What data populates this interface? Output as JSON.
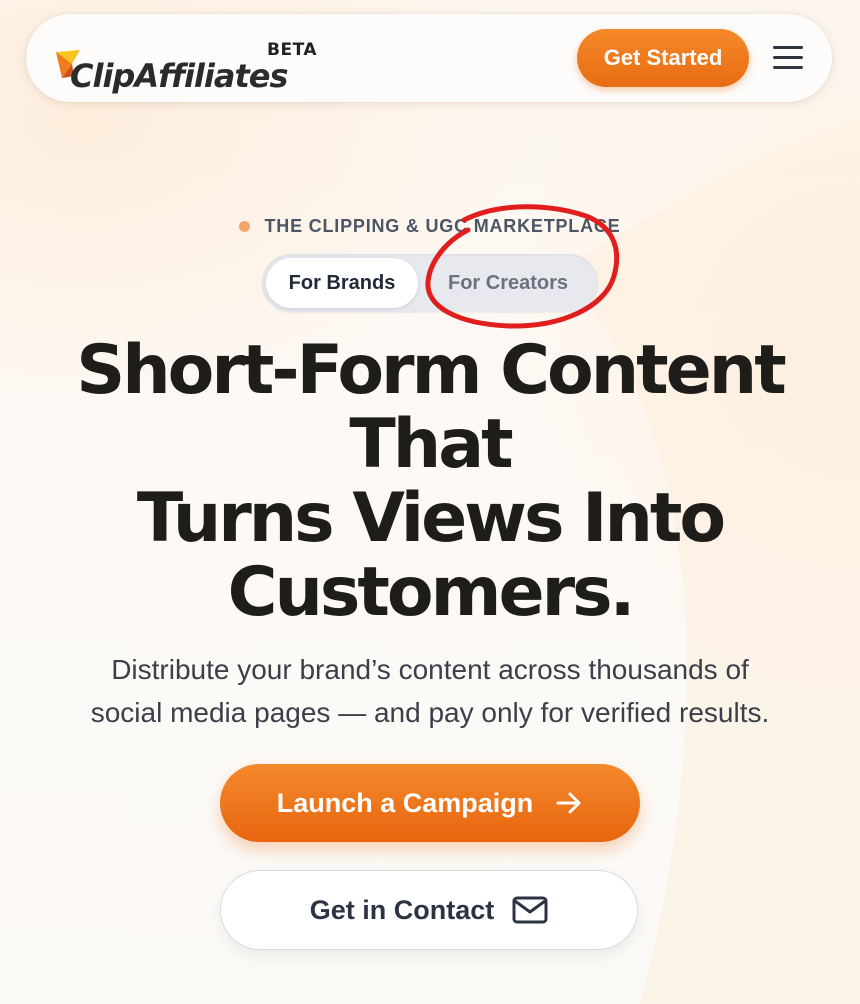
{
  "header": {
    "brand": "ClipAffiliates",
    "badge": "BETA",
    "cta_label": "Get Started",
    "menu_icon": "hamburger-menu-icon"
  },
  "hero": {
    "eyebrow": "THE CLIPPING & UGC MARKETPLACE",
    "toggle": {
      "options": [
        "For Brands",
        "For Creators"
      ],
      "selected": "For Brands"
    },
    "headline_lines": [
      "Short-Form Content",
      "That",
      "Turns Views Into",
      "Customers."
    ],
    "subhead_lines": [
      "Distribute your brand’s content across thousands of",
      "social media pages — and pay only for verified results."
    ],
    "primary_cta": {
      "label": "Launch a Campaign",
      "icon": "arrow-right-icon"
    },
    "secondary_cta": {
      "label": "Get in Contact",
      "icon": "mail-icon"
    }
  },
  "colors": {
    "accent": "#ee7a1c",
    "headline": "#1f1d1a",
    "annotation": "#e01e1e"
  }
}
